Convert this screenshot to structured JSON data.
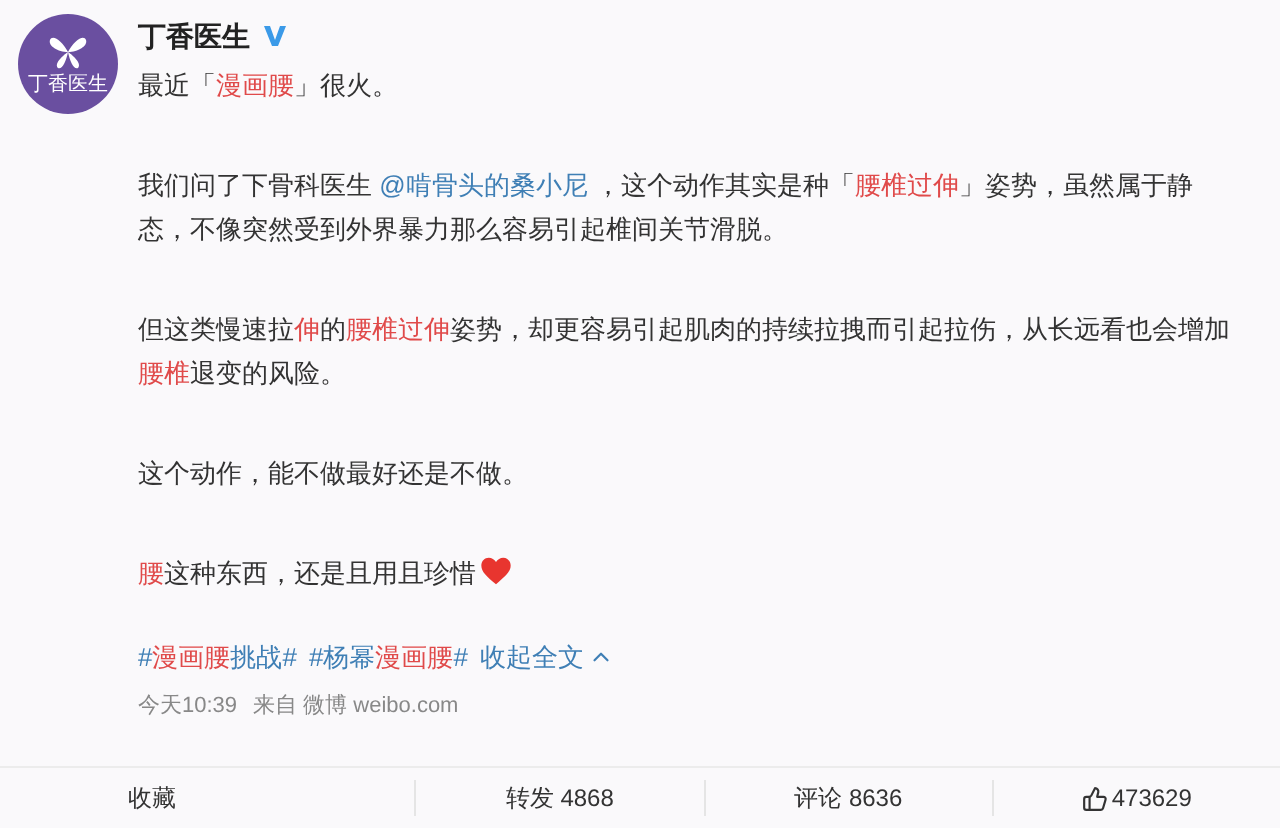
{
  "account": {
    "name": "丁香医生",
    "avatar_label": "丁香医生",
    "verified": true
  },
  "paragraphs": [
    {
      "segments": [
        {
          "kind": "text",
          "text": "最近「"
        },
        {
          "kind": "highlight",
          "text": "漫画腰"
        },
        {
          "kind": "text",
          "text": "」很火。"
        }
      ]
    },
    {
      "segments": [
        {
          "kind": "text",
          "text": "我们问了下骨科医生 "
        },
        {
          "kind": "mention",
          "text": "@啃骨头的桑小尼"
        },
        {
          "kind": "text",
          "text": " ，这个动作其实是种「"
        },
        {
          "kind": "highlight",
          "text": "腰椎过伸"
        },
        {
          "kind": "text",
          "text": "」姿势，虽然属于静态，不像突然受到外界暴力那么容易引起椎间关节滑脱。"
        }
      ]
    },
    {
      "segments": [
        {
          "kind": "text",
          "text": "但这类慢速拉"
        },
        {
          "kind": "highlight",
          "text": "伸"
        },
        {
          "kind": "text",
          "text": "的"
        },
        {
          "kind": "highlight",
          "text": "腰椎过伸"
        },
        {
          "kind": "text",
          "text": "姿势，却更容易引起肌肉的持续拉拽而引起拉伤，从长远看也会增加"
        },
        {
          "kind": "highlight",
          "text": "腰椎"
        },
        {
          "kind": "text",
          "text": "退变的风险。"
        }
      ]
    },
    {
      "segments": [
        {
          "kind": "text",
          "text": "这个动作，能不做最好还是不做。"
        }
      ]
    },
    {
      "segments": [
        {
          "kind": "highlight",
          "text": "腰"
        },
        {
          "kind": "text",
          "text": "这种东西，还是且用且珍惜"
        },
        {
          "kind": "heart"
        }
      ]
    }
  ],
  "topics": [
    {
      "segments": [
        {
          "kind": "text",
          "text": "#"
        },
        {
          "kind": "highlight",
          "text": "漫画腰"
        },
        {
          "kind": "text",
          "text": "挑战#"
        }
      ]
    },
    {
      "segments": [
        {
          "kind": "text",
          "text": "#杨幂"
        },
        {
          "kind": "highlight",
          "text": "漫画腰"
        },
        {
          "kind": "text",
          "text": "#"
        }
      ]
    }
  ],
  "collapse_link": "收起全文",
  "time": "今天10:39",
  "source": "来自 微博 weibo.com",
  "actions": [
    {
      "kind": "text",
      "label": "收藏"
    },
    {
      "kind": "text",
      "label": "转发 4868"
    },
    {
      "kind": "text",
      "label": "评论 8636"
    },
    {
      "kind": "like",
      "label": "473629"
    }
  ]
}
